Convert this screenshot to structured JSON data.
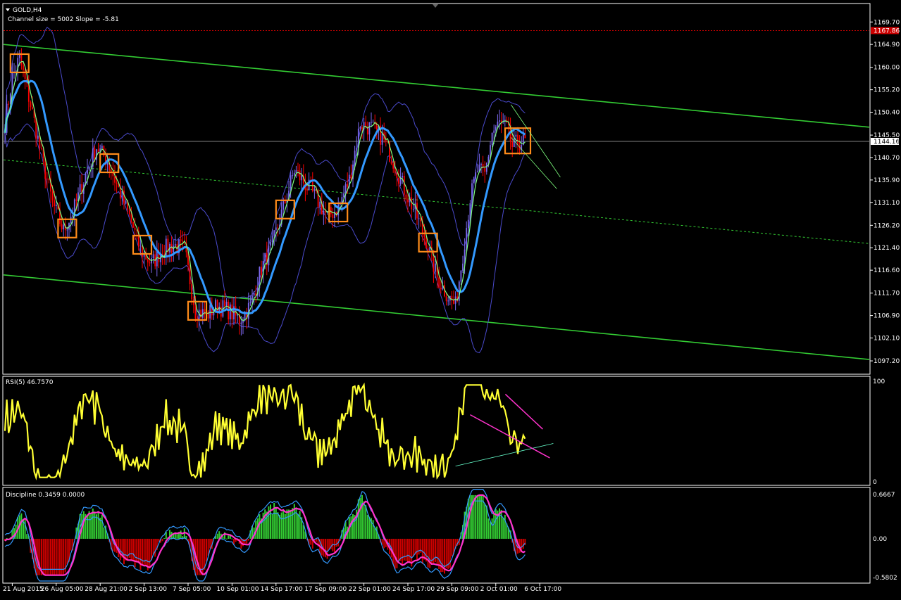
{
  "window": {
    "symbol_label": "GOLD,H4",
    "channel_info": "Channel size = 5002 Slope = -5.81"
  },
  "colors": {
    "background": "#000000",
    "frame": "#ffffff",
    "bull": "#7b68ee",
    "bear": "#ff0000",
    "channel": "#33cc33",
    "midline": "#33cc33",
    "fast_ma": "#7fff7f",
    "slow_ma": "#3399ff",
    "bands": "#4a4acc",
    "box": "#ff8c1a",
    "rsi": "#ffff33",
    "rsi_trend": "#ff33cc",
    "rsi_support": "#66ffcc",
    "disc_pos": "#33cc33",
    "disc_neg": "#cc0000",
    "disc_line1": "#ff33cc",
    "disc_line2": "#3399ff",
    "ask_line": "#cc0000",
    "price_tag_bg": "#cc0000",
    "current_tag_bg": "#ffffff"
  },
  "chart_data": [
    {
      "type": "candlestick",
      "title": "GOLD,H4",
      "subtitle": "Channel size = 5002 Slope = -5.81",
      "ylim": [
        1094.5,
        1173.5
      ],
      "y_ticks": [
        1169.7,
        1164.9,
        1160.0,
        1155.2,
        1150.4,
        1145.5,
        1140.7,
        1135.9,
        1131.1,
        1126.2,
        1121.4,
        1116.6,
        1111.7,
        1106.9,
        1102.1,
        1097.2
      ],
      "y_tick_labels": [
        "1169.70",
        "1164.90",
        "1160.00",
        "1155.20",
        "1150.40",
        "1145.50",
        "1140.70",
        "1135.90",
        "1131.10",
        "1126.20",
        "1121.40",
        "1116.60",
        "1111.70",
        "1106.90",
        "1102.10",
        "1097.20"
      ],
      "current_price": 1144.16,
      "current_price_label": "1144.16",
      "ask_price": 1167.86,
      "ask_price_label": "1167.86",
      "anchors": [
        [
          0,
          1148
        ],
        [
          4,
          1158
        ],
        [
          8,
          1162
        ],
        [
          14,
          1152
        ],
        [
          20,
          1141
        ],
        [
          26,
          1131
        ],
        [
          32,
          1125
        ],
        [
          38,
          1130
        ],
        [
          44,
          1137
        ],
        [
          50,
          1143
        ],
        [
          56,
          1140
        ],
        [
          62,
          1134
        ],
        [
          68,
          1128
        ],
        [
          74,
          1121
        ],
        [
          80,
          1118
        ],
        [
          86,
          1121
        ],
        [
          92,
          1122
        ],
        [
          98,
          1121
        ],
        [
          104,
          1108
        ],
        [
          110,
          1107
        ],
        [
          116,
          1109
        ],
        [
          122,
          1108
        ],
        [
          128,
          1106
        ],
        [
          134,
          1109
        ],
        [
          140,
          1117
        ],
        [
          146,
          1122
        ],
        [
          152,
          1130
        ],
        [
          158,
          1138
        ],
        [
          164,
          1135
        ],
        [
          170,
          1132
        ],
        [
          176,
          1128
        ],
        [
          182,
          1130
        ],
        [
          188,
          1136
        ],
        [
          194,
          1148
        ],
        [
          200,
          1147
        ],
        [
          206,
          1145
        ],
        [
          212,
          1140
        ],
        [
          218,
          1134
        ],
        [
          224,
          1129
        ],
        [
          230,
          1123
        ],
        [
          236,
          1115
        ],
        [
          242,
          1111
        ],
        [
          246,
          1109
        ],
        [
          250,
          1120
        ],
        [
          254,
          1132
        ],
        [
          258,
          1138
        ],
        [
          262,
          1137
        ],
        [
          266,
          1146
        ],
        [
          270,
          1148
        ],
        [
          274,
          1147
        ],
        [
          277,
          1143
        ],
        [
          280,
          1144
        ]
      ],
      "upper_channel": {
        "start": 1164.9,
        "end": 1147.2
      },
      "lower_channel": {
        "start": 1115.6,
        "end": 1097.5
      },
      "mid_channel": {
        "start": 1140.2,
        "end": 1122.3
      },
      "marked_bars": [
        8,
        34,
        57,
        75,
        105,
        153,
        182,
        231,
        280
      ]
    },
    {
      "type": "line",
      "title": "RSI(5) 46.7570",
      "ylim": [
        0,
        100
      ],
      "y_tick_labels": [
        "100",
        "0"
      ],
      "series_name": "RSI(5)",
      "last_value": 46.757
    },
    {
      "type": "bar",
      "title": "Discipline 0.3459 0.0000",
      "ylim": [
        -0.5802,
        0.6667
      ],
      "y_tick_labels": [
        "0.6667",
        "0.00",
        "-0.5802"
      ],
      "values_shown": [
        0.3459,
        0.0
      ]
    }
  ],
  "x_axis_labels": [
    {
      "bar": 4,
      "text": "21 Aug 2015"
    },
    {
      "bar": 28,
      "text": "26 Aug 05:00"
    },
    {
      "bar": 52,
      "text": "28 Aug 21:00"
    },
    {
      "bar": 76,
      "text": "2 Sep 13:00"
    },
    {
      "bar": 100,
      "text": "7 Sep 05:00"
    },
    {
      "bar": 124,
      "text": "10 Sep 01:00"
    },
    {
      "bar": 148,
      "text": "14 Sep 17:00"
    },
    {
      "bar": 172,
      "text": "17 Sep 09:00"
    },
    {
      "bar": 196,
      "text": "22 Sep 01:00"
    },
    {
      "bar": 220,
      "text": "24 Sep 17:00"
    },
    {
      "bar": 244,
      "text": "29 Sep 09:00"
    },
    {
      "bar": 268,
      "text": "2 Oct 01:00"
    },
    {
      "bar": 292,
      "text": "6 Oct 17:00"
    }
  ],
  "labels": {
    "main_header": "GOLD,H4",
    "channel_info": "Channel size = 5002 Slope = -5.81",
    "rsi_header": "RSI(5) 46.7570",
    "rsi_top": "100",
    "rsi_bottom": "0",
    "disc_header": "Discipline 0.3459 0.0000",
    "disc_top": "0.6667",
    "disc_mid": "0.00",
    "disc_bottom": "-0.5802"
  }
}
